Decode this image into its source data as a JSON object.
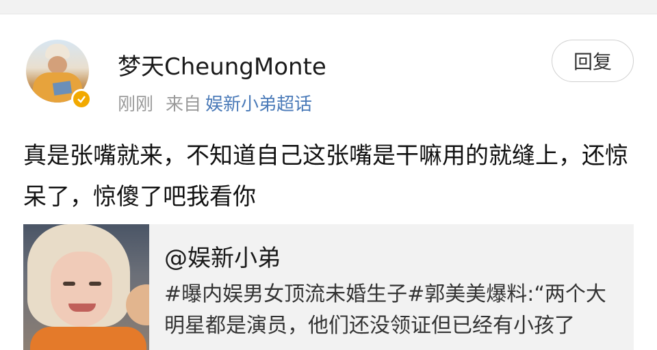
{
  "post": {
    "username": "梦天CheungMonte",
    "time": "刚刚",
    "source_prefix": "来自",
    "source_topic": "娱新小弟超话",
    "reply_label": "回复",
    "text": "真是张嘴就来，不知道自己这张嘴是干嘛用的就缝上，还惊呆了，惊傻了吧我看你"
  },
  "quote": {
    "author": "@娱新小弟",
    "text": "#曝内娱男女顶流未婚生子#郭美美爆料:“两个大明星都是演员，他们还没领证但已经有小孩了"
  },
  "icons": {
    "avatar": "user-avatar",
    "verified": "verified-badge-icon",
    "thumb": "quoted-image-thumbnail"
  },
  "colors": {
    "topic_link": "#4a7ab8",
    "verified_badge": "#f2a900"
  }
}
